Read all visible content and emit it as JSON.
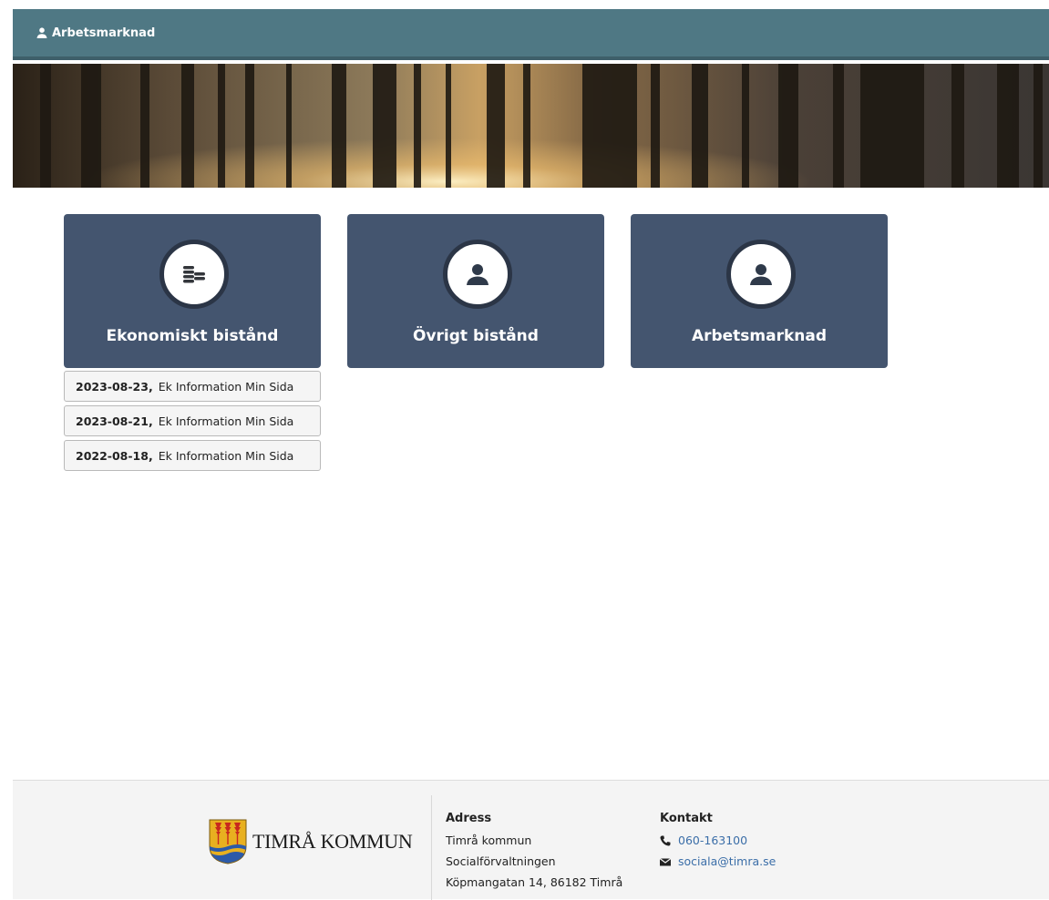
{
  "header": {
    "nav_label": "Arbetsmarknad",
    "nav_icon": "user-icon",
    "bg_color": "#4f7884"
  },
  "tiles": [
    {
      "label": "Ekonomiskt bistånd",
      "icon": "coins-icon"
    },
    {
      "label": "Övrigt bistånd",
      "icon": "user-icon"
    },
    {
      "label": "Arbetsmarknad",
      "icon": "user-icon"
    }
  ],
  "documents": [
    {
      "date": "2023-08-23,",
      "title": "Ek Information Min Sida"
    },
    {
      "date": "2023-08-21,",
      "title": "Ek Information Min Sida"
    },
    {
      "date": "2022-08-18,",
      "title": "Ek Information Min Sida"
    }
  ],
  "footer": {
    "logo_text": "TIMRÅ KOMMUN",
    "address": {
      "heading": "Adress",
      "lines": [
        "Timrå kommun",
        "Socialförvaltningen",
        "Köpmangatan 14, 86182 Timrå"
      ]
    },
    "contact": {
      "heading": "Kontakt",
      "phone": "060-163100",
      "email": "sociala@timra.se"
    }
  },
  "colors": {
    "tile_bg": "#44556f",
    "link": "#3b6ea8"
  }
}
